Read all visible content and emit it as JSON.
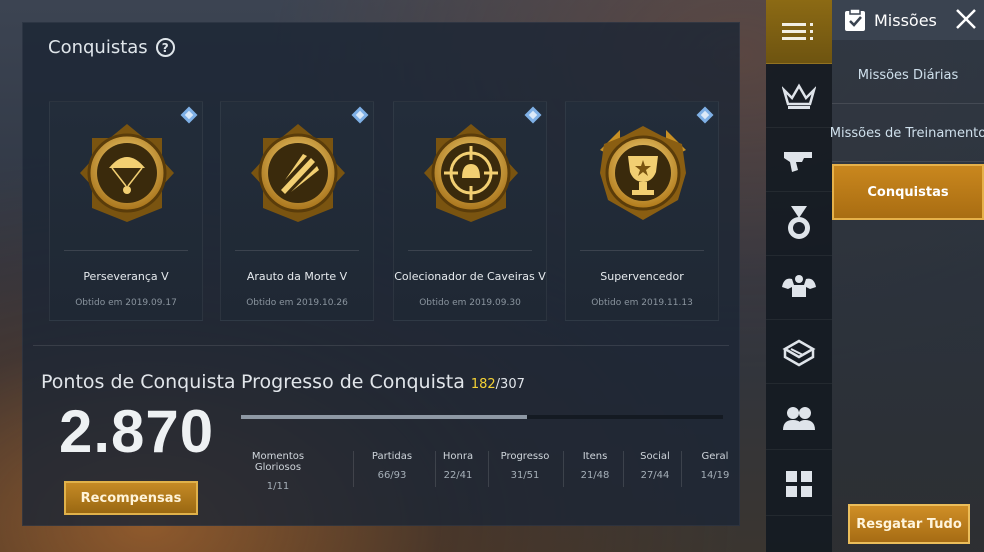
{
  "achievements": {
    "title": "Conquistas",
    "cards": [
      {
        "name": "Perseverança V",
        "date": "Obtido em 2019.09.17",
        "icon": "parachute-medal-icon"
      },
      {
        "name": "Arauto da Morte V",
        "date": "Obtido em 2019.10.26",
        "icon": "bullet-medal-icon"
      },
      {
        "name": "Colecionador de Caveiras V",
        "date": "Obtido em 2019.09.30",
        "icon": "crosshair-helmet-medal-icon"
      },
      {
        "name": "Supervencedor",
        "date": "Obtido em 2019.11.13",
        "icon": "trophy-medal-icon"
      }
    ]
  },
  "points": {
    "label": "Pontos de Conquista",
    "value": "2.870",
    "reward_button": "Recompensas"
  },
  "progress": {
    "title": "Progresso de Conquista",
    "current": "182",
    "total": "/307",
    "fraction": 0.593,
    "categories": [
      {
        "label": "Momentos Gloriosos",
        "value": "1/11"
      },
      {
        "label": "Partidas",
        "value": "66/93"
      },
      {
        "label": "Honra",
        "value": "22/41"
      },
      {
        "label": "Progresso",
        "value": "31/51"
      },
      {
        "label": "Itens",
        "value": "21/48"
      },
      {
        "label": "Social",
        "value": "27/44"
      },
      {
        "label": "Geral",
        "value": "14/19"
      }
    ]
  },
  "sidebar": {
    "items": [
      "menu-icon",
      "crown-icon",
      "gun-icon",
      "medal-icon",
      "muscle-icon",
      "ammo-box-icon",
      "friends-icon",
      "grid-icon"
    ]
  },
  "missions_panel": {
    "title": "Missões",
    "items": [
      "Missões Diárias",
      "Missões de Treinamento",
      "Conquistas"
    ],
    "active_index": 2,
    "claim_all": "Resgatar Tudo"
  },
  "colors": {
    "gold": "#c9871e",
    "highlight": "#f4d135",
    "panel": "#1c2634"
  }
}
